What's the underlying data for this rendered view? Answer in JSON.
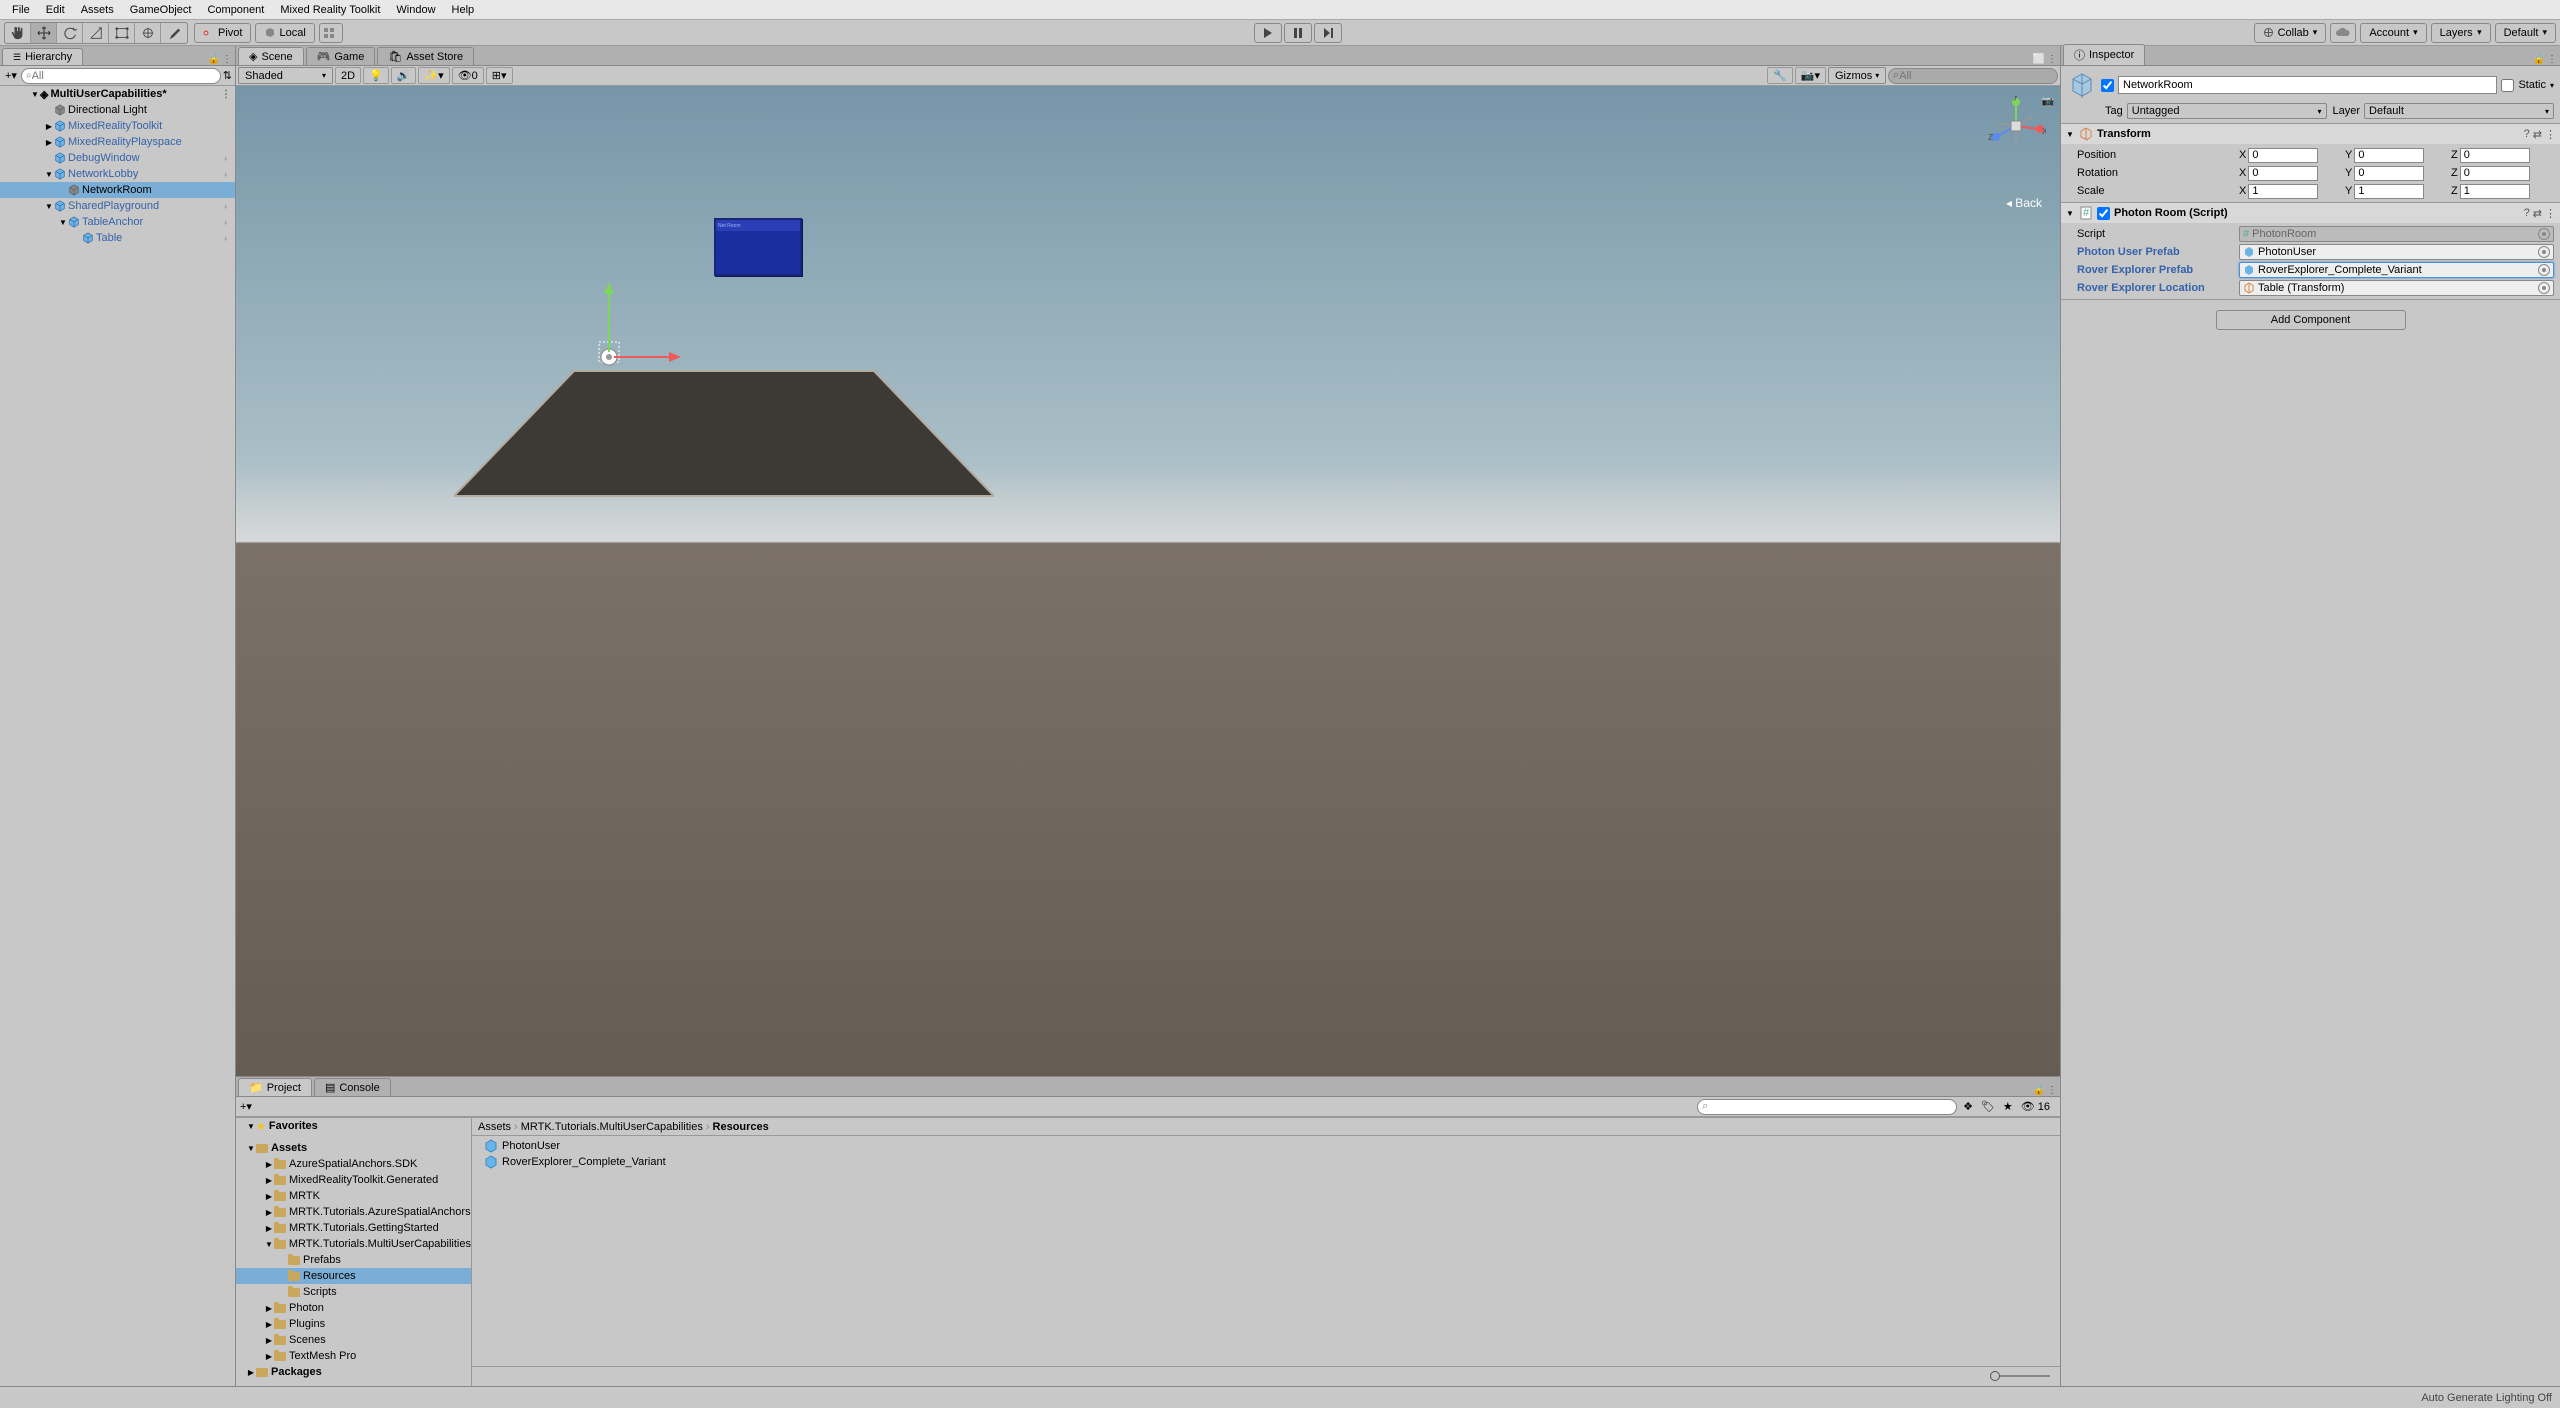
{
  "menu": [
    "File",
    "Edit",
    "Assets",
    "GameObject",
    "Component",
    "Mixed Reality Toolkit",
    "Window",
    "Help"
  ],
  "toolbar": {
    "pivot": "Pivot",
    "local": "Local",
    "collab": "Collab",
    "account": "Account",
    "layers": "Layers",
    "layout": "Default"
  },
  "hierarchy": {
    "tab": "Hierarchy",
    "search_placeholder": "All",
    "scene": "MultiUserCapabilities*",
    "items": [
      {
        "name": "Directional Light",
        "indent": 44,
        "prefab": false
      },
      {
        "name": "MixedRealityToolkit",
        "indent": 44,
        "prefab": true,
        "fold": "▶"
      },
      {
        "name": "MixedRealityPlayspace",
        "indent": 44,
        "prefab": true,
        "fold": "▶"
      },
      {
        "name": "DebugWindow",
        "indent": 44,
        "prefab": true,
        "fold": "",
        "arrow": true
      },
      {
        "name": "NetworkLobby",
        "indent": 44,
        "prefab": true,
        "fold": "▼",
        "arrow": true
      },
      {
        "name": "NetworkRoom",
        "indent": 58,
        "prefab": false,
        "selected": true
      },
      {
        "name": "SharedPlayground",
        "indent": 44,
        "prefab": true,
        "fold": "▼",
        "arrow": true
      },
      {
        "name": "TableAnchor",
        "indent": 58,
        "prefab": true,
        "fold": "▼",
        "arrow": true
      },
      {
        "name": "Table",
        "indent": 72,
        "prefab": true,
        "fold": "",
        "arrow": true
      }
    ]
  },
  "scene_tabs": {
    "scene": "Scene",
    "game": "Game",
    "asset_store": "Asset Store",
    "shading": "Shaded",
    "mode2d": "2D",
    "gizmos": "Gizmos",
    "search_placeholder": "All",
    "back": "◂ Back",
    "zero": "0"
  },
  "project_tabs": {
    "project": "Project",
    "console": "Console"
  },
  "project": {
    "favorites": "Favorites",
    "assets": "Assets",
    "folders": [
      {
        "name": "AzureSpatialAnchors.SDK",
        "indent": 28
      },
      {
        "name": "MixedRealityToolkit.Generated",
        "indent": 28
      },
      {
        "name": "MRTK",
        "indent": 28
      },
      {
        "name": "MRTK.Tutorials.AzureSpatialAnchors",
        "indent": 28
      },
      {
        "name": "MRTK.Tutorials.GettingStarted",
        "indent": 28
      },
      {
        "name": "MRTK.Tutorials.MultiUserCapabilities",
        "indent": 28,
        "open": true
      },
      {
        "name": "Prefabs",
        "indent": 42
      },
      {
        "name": "Resources",
        "indent": 42,
        "selected": true
      },
      {
        "name": "Scripts",
        "indent": 42
      },
      {
        "name": "Photon",
        "indent": 28
      },
      {
        "name": "Plugins",
        "indent": 28
      },
      {
        "name": "Scenes",
        "indent": 28
      },
      {
        "name": "TextMesh Pro",
        "indent": 28
      }
    ],
    "packages": "Packages",
    "breadcrumb": [
      "Assets",
      "MRTK.Tutorials.MultiUserCapabilities",
      "Resources"
    ],
    "items": [
      "PhotonUser",
      "RoverExplorer_Complete_Variant"
    ],
    "hidden_count": "16"
  },
  "inspector": {
    "tab": "Inspector",
    "name": "NetworkRoom",
    "static": "Static",
    "tag_label": "Tag",
    "tag": "Untagged",
    "layer_label": "Layer",
    "layer": "Default",
    "transform": {
      "title": "Transform",
      "rows": [
        {
          "label": "Position",
          "x": "0",
          "y": "0",
          "z": "0"
        },
        {
          "label": "Rotation",
          "x": "0",
          "y": "0",
          "z": "0"
        },
        {
          "label": "Scale",
          "x": "1",
          "y": "1",
          "z": "1"
        }
      ]
    },
    "photon": {
      "title": "Photon Room (Script)",
      "script_label": "Script",
      "script": "PhotonRoom",
      "rows": [
        {
          "label": "Photon User Prefab",
          "value": "PhotonUser",
          "linked": true
        },
        {
          "label": "Rover Explorer Prefab",
          "value": "RoverExplorer_Complete_Variant",
          "linked": true,
          "highlighted": true
        },
        {
          "label": "Rover Explorer Location",
          "value": "Table (Transform)",
          "linked": true
        }
      ]
    },
    "add_component": "Add Component"
  },
  "statusbar": "Auto Generate Lighting Off",
  "axis": {
    "x": "x",
    "y": "y",
    "z": "z"
  }
}
